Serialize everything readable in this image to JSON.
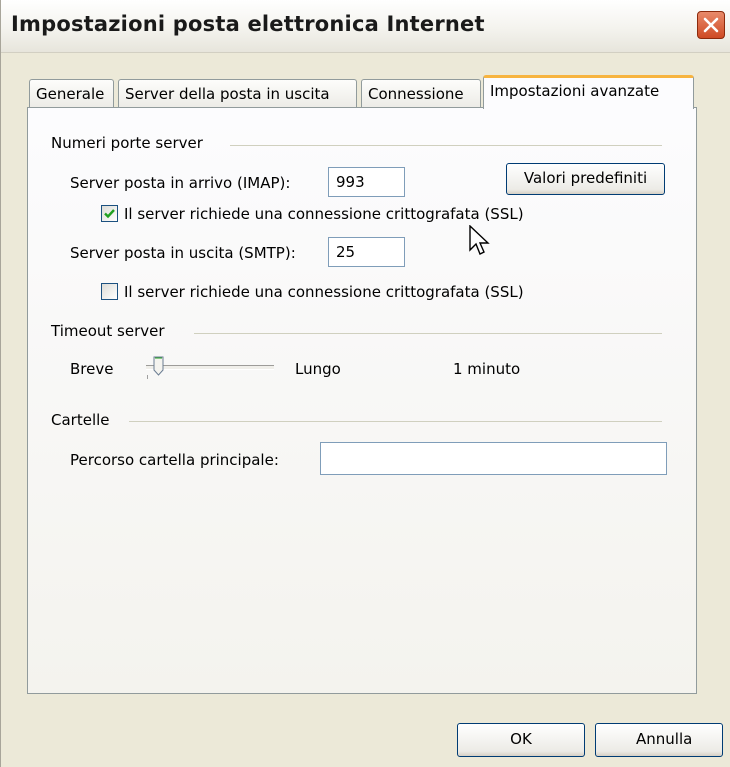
{
  "window": {
    "title": "Impostazioni posta elettronica Internet"
  },
  "tabs": [
    {
      "label": "Generale",
      "active": false
    },
    {
      "label": "Server della posta in uscita",
      "active": false
    },
    {
      "label": "Connessione",
      "active": false
    },
    {
      "label": "Impostazioni avanzate",
      "active": true
    }
  ],
  "ports": {
    "group_label": "Numeri porte server",
    "incoming_label": "Server posta in arrivo (IMAP):",
    "incoming_value": "993",
    "defaults_button": "Valori predefiniti",
    "incoming_ssl_label": "Il server richiede una connessione crittografata (SSL)",
    "incoming_ssl_checked": true,
    "outgoing_label": "Server posta in uscita (SMTP):",
    "outgoing_value": "25",
    "outgoing_ssl_label": "Il server richiede una connessione crittografata (SSL)",
    "outgoing_ssl_checked": false
  },
  "timeout": {
    "group_label": "Timeout server",
    "short_label": "Breve",
    "long_label": "Lungo",
    "value_text": "1 minuto"
  },
  "folders": {
    "group_label": "Cartelle",
    "root_path_label": "Percorso cartella principale:",
    "root_path_value": ""
  },
  "footer": {
    "ok_label": "OK",
    "cancel_label": "Annulla"
  },
  "colors": {
    "accent_tab": "#f7b440",
    "check": "#21a121",
    "close": "#cf4a24"
  }
}
